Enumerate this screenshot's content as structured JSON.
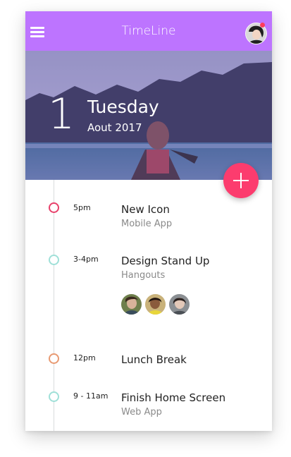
{
  "app": {
    "title": "TimeLine",
    "accent": "#bd74ff",
    "fab_color": "#fc3c6e"
  },
  "header": {
    "menu_icon": "hamburger-menu-icon",
    "avatar": "user-avatar"
  },
  "hero": {
    "day_number": "1",
    "weekday": "Tuesday",
    "month_year": "Aout 2017"
  },
  "fab": {
    "icon": "plus-icon"
  },
  "events": [
    {
      "time": "5pm",
      "title": "New Icon",
      "subtitle": "Mobile App",
      "dot_color": "#e8416b"
    },
    {
      "time": "3-4pm",
      "title": "Design Stand Up",
      "subtitle": "Hangouts",
      "dot_color": "#9fe0d8",
      "attendees": [
        "attendee-1",
        "attendee-2",
        "attendee-3"
      ]
    },
    {
      "time": "12pm",
      "title": "Lunch Break",
      "subtitle": "",
      "dot_color": "#e89a72"
    },
    {
      "time": "9 - 11am",
      "title": "Finish Home Screen",
      "subtitle": "Web App",
      "dot_color": "#9fe0d8"
    }
  ]
}
